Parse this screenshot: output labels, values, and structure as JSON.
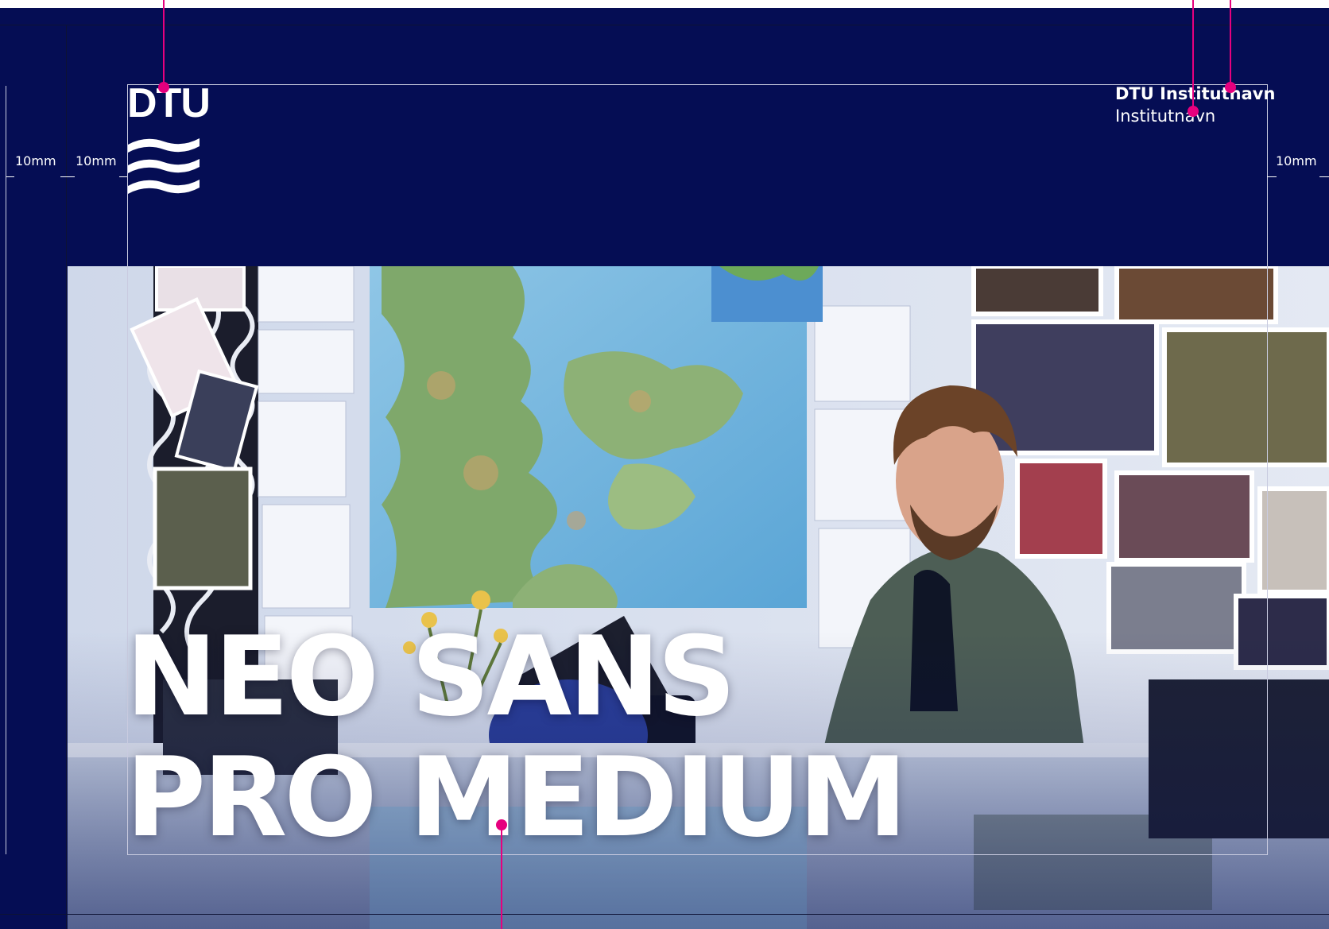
{
  "header": {
    "logo_text": "DTU",
    "department_name": "DTU Institutnavn",
    "department_subtitle": "Institutnavn"
  },
  "headline": {
    "line1": "NEO SANS",
    "line2": "PRO MEDIUM"
  },
  "measurements": {
    "left_outer": "10mm",
    "left_inner": "10mm",
    "right": "10mm"
  },
  "colors": {
    "background": "#050d54",
    "callout": "#e6007e",
    "text": "#ffffff",
    "guide": "#c9cbe0"
  },
  "icons": {
    "logo": "dtu-waves-logo",
    "callout": "pink-callout-dot"
  }
}
